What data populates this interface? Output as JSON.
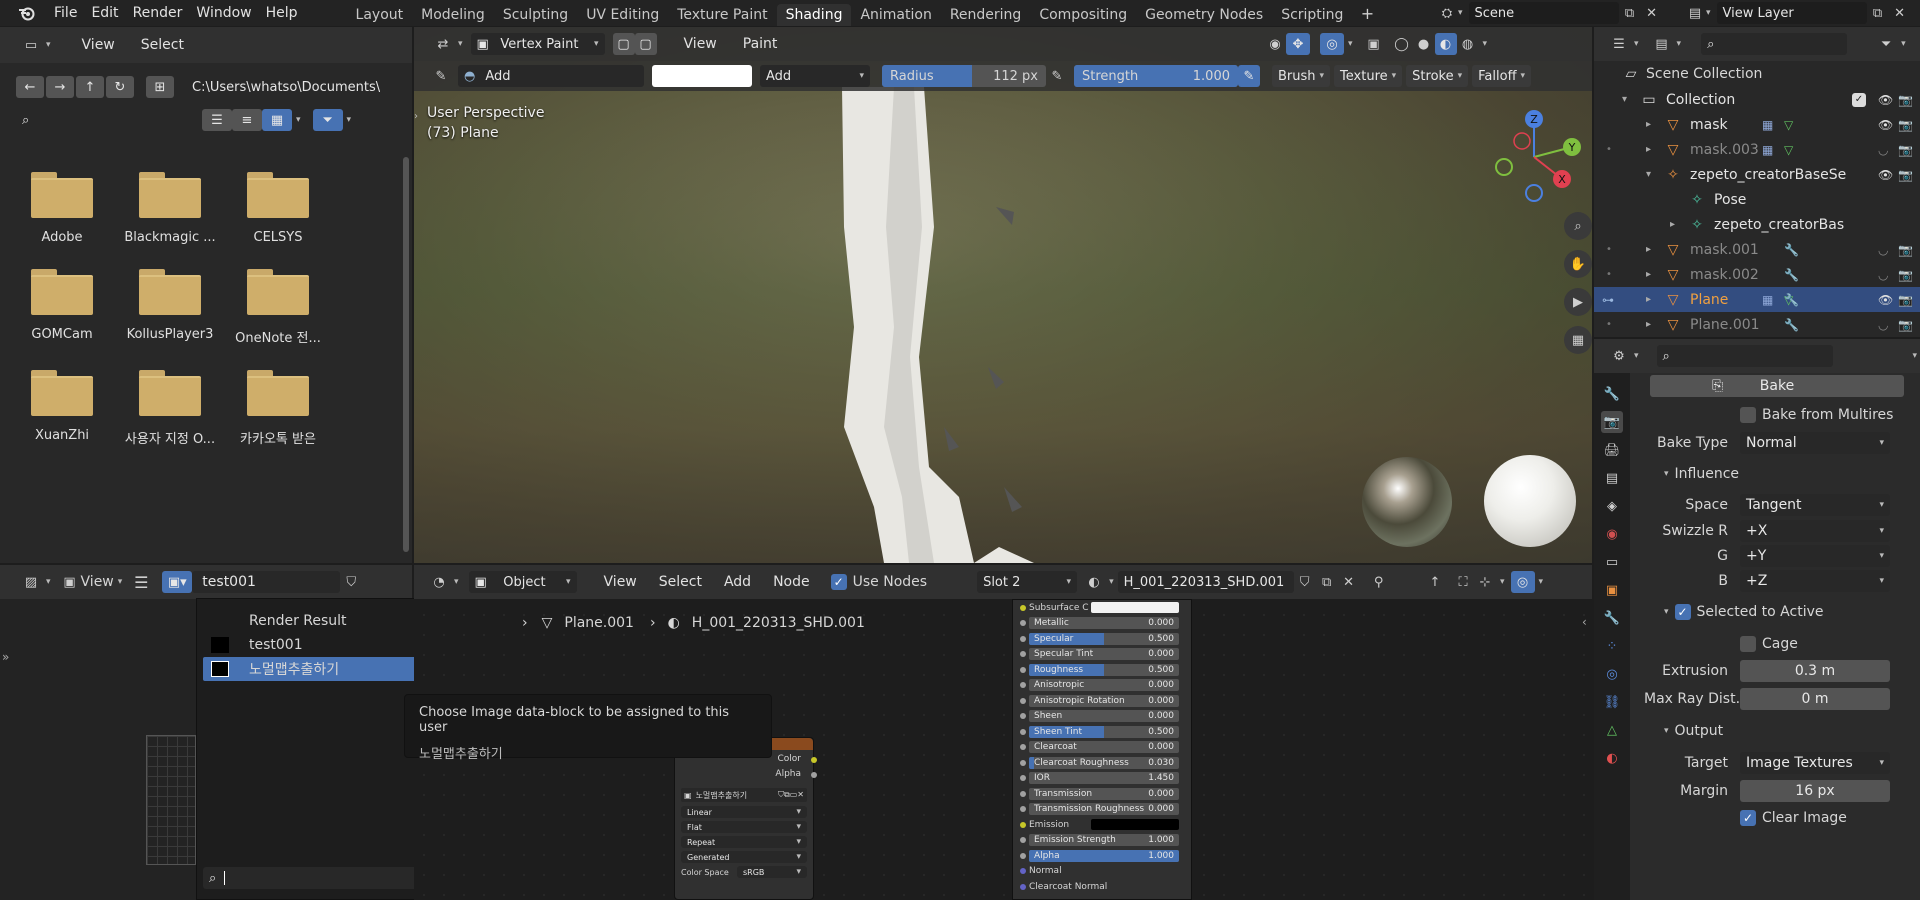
{
  "topbar": {
    "menus": [
      "File",
      "Edit",
      "Render",
      "Window",
      "Help"
    ],
    "workspaces": [
      "Layout",
      "Modeling",
      "Sculpting",
      "UV Editing",
      "Texture Paint",
      "Shading",
      "Animation",
      "Rendering",
      "Compositing",
      "Geometry Nodes",
      "Scripting"
    ],
    "active_workspace": "Shading",
    "scene": "Scene",
    "view_layer": "View Layer"
  },
  "filebrowser": {
    "menu_view": "View",
    "menu_select": "Select",
    "path": "C:\\Users\\whatso\\Documents\\",
    "folders": [
      "Adobe",
      "Blackmagic ...",
      "CELSYS",
      "GOMCam",
      "KollusPlayer3",
      "OneNote 전...",
      "XuanZhi",
      "사용자 지정 O...",
      "카카오톡 받은"
    ]
  },
  "viewport": {
    "mode": "Vertex Paint",
    "menu_view": "View",
    "menu_paint": "Paint",
    "brush_name": "Add",
    "blend": "Add",
    "radius_label": "Radius",
    "radius_value": "112 px",
    "strength_label": "Strength",
    "strength_value": "1.000",
    "strength_fraction": 1.0,
    "radius_fraction": 0.55,
    "menus": [
      "Brush",
      "Texture",
      "Stroke",
      "Falloff"
    ],
    "overlay_line1": "User Perspective",
    "overlay_line2": "(73) Plane",
    "gizmo": {
      "x": "X",
      "y": "Y",
      "z": "Z"
    }
  },
  "outliner": {
    "root": "Scene Collection",
    "items": [
      {
        "name": "Collection",
        "icon": "collection-icon",
        "dim": false,
        "selected": false
      },
      {
        "name": "mask",
        "icon": "mesh-icon",
        "dim": false,
        "selected": false
      },
      {
        "name": "mask.003",
        "icon": "mesh-icon",
        "dim": true,
        "selected": false
      },
      {
        "name": "zepeto_creatorBaseSe",
        "icon": "armature-icon",
        "dim": false,
        "selected": false
      },
      {
        "name": "Pose",
        "icon": "pose-icon",
        "dim": false,
        "selected": false
      },
      {
        "name": "zepeto_creatorBas",
        "icon": "armature-data-icon",
        "dim": false,
        "selected": false
      },
      {
        "name": "mask.001",
        "icon": "mesh-icon",
        "dim": true,
        "selected": false
      },
      {
        "name": "mask.002",
        "icon": "mesh-icon",
        "dim": true,
        "selected": false
      },
      {
        "name": "Plane",
        "icon": "mesh-icon",
        "dim": false,
        "selected": true
      },
      {
        "name": "Plane.001",
        "icon": "mesh-icon",
        "dim": true,
        "selected": false
      }
    ]
  },
  "properties": {
    "bake_button": "Bake",
    "bake_from_multires": "Bake from Multires",
    "bake_type_label": "Bake Type",
    "bake_type": "Normal",
    "influence": "Influence",
    "space_label": "Space",
    "space": "Tangent",
    "swizzle_r_label": "Swizzle R",
    "swizzle_r": "+X",
    "g_label": "G",
    "g": "+Y",
    "b_label": "B",
    "b": "+Z",
    "selected_to_active": "Selected to Active",
    "cage": "Cage",
    "extrusion_label": "Extrusion",
    "extrusion": "0.3 m",
    "max_ray_label": "Max Ray Dist...",
    "max_ray": "0 m",
    "output": "Output",
    "target_label": "Target",
    "target": "Image Textures",
    "margin_label": "Margin",
    "margin": "16 px",
    "clear_image": "Clear Image"
  },
  "image_editor": {
    "view": "View",
    "image_name": "test001",
    "dropdown_items": [
      "Render Result",
      "test001",
      "노멀맵추출하기"
    ],
    "selected_item": "노멀맵추출하기",
    "tooltip_title": "Choose Image data-block to be assigned to this user",
    "tooltip_value": "노멀맵추출하기"
  },
  "node_editor": {
    "object": "Object",
    "menus": [
      "View",
      "Select",
      "Add",
      "Node"
    ],
    "use_nodes": "Use Nodes",
    "slot": "Slot 2",
    "material": "H_001_220313_SHD.001",
    "breadcrumb_object": "Plane.001",
    "breadcrumb_material": "H_001_220313_SHD.001",
    "image_node": {
      "out_color": "Color",
      "out_alpha": "Alpha",
      "image": "노멀맵추출하기",
      "interpolation": "Linear",
      "projection": "Flat",
      "extension": "Repeat",
      "source": "Generated",
      "color_space_label": "Color Space",
      "color_space": "sRGB"
    },
    "bsdf_rows": [
      {
        "label": "Subsurface C...",
        "value": "",
        "kind": "color",
        "fill": 0
      },
      {
        "label": "Metallic",
        "value": "0.000",
        "kind": "num",
        "fill": 0
      },
      {
        "label": "Specular",
        "value": "0.500",
        "kind": "num",
        "fill": 0.5
      },
      {
        "label": "Specular Tint",
        "value": "0.000",
        "kind": "num",
        "fill": 0
      },
      {
        "label": "Roughness",
        "value": "0.500",
        "kind": "num",
        "fill": 0.5
      },
      {
        "label": "Anisotropic",
        "value": "0.000",
        "kind": "num",
        "fill": 0
      },
      {
        "label": "Anisotropic Rotation",
        "value": "0.000",
        "kind": "num",
        "fill": 0
      },
      {
        "label": "Sheen",
        "value": "0.000",
        "kind": "num",
        "fill": 0
      },
      {
        "label": "Sheen Tint",
        "value": "0.500",
        "kind": "num",
        "fill": 0.5
      },
      {
        "label": "Clearcoat",
        "value": "0.000",
        "kind": "num",
        "fill": 0
      },
      {
        "label": "Clearcoat Roughness",
        "value": "0.030",
        "kind": "num",
        "fill": 0.03
      },
      {
        "label": "IOR",
        "value": "1.450",
        "kind": "num",
        "fill": 0
      },
      {
        "label": "Transmission",
        "value": "0.000",
        "kind": "num",
        "fill": 0
      },
      {
        "label": "Transmission Roughness",
        "value": "0.000",
        "kind": "num",
        "fill": 0
      },
      {
        "label": "Emission",
        "value": "",
        "kind": "black",
        "fill": 0
      },
      {
        "label": "Emission Strength",
        "value": "1.000",
        "kind": "num",
        "fill": 0
      },
      {
        "label": "Alpha",
        "value": "1.000",
        "kind": "num",
        "fill": 1.0
      },
      {
        "label": "Normal",
        "value": "",
        "kind": "socket",
        "fill": 0
      },
      {
        "label": "Clearcoat Normal",
        "value": "",
        "kind": "socket",
        "fill": 0
      }
    ]
  },
  "colors": {
    "accent": "#4772b3",
    "selected_row": "#334d80",
    "selected_text": "#f0a040",
    "folder": "#cfae6a"
  }
}
